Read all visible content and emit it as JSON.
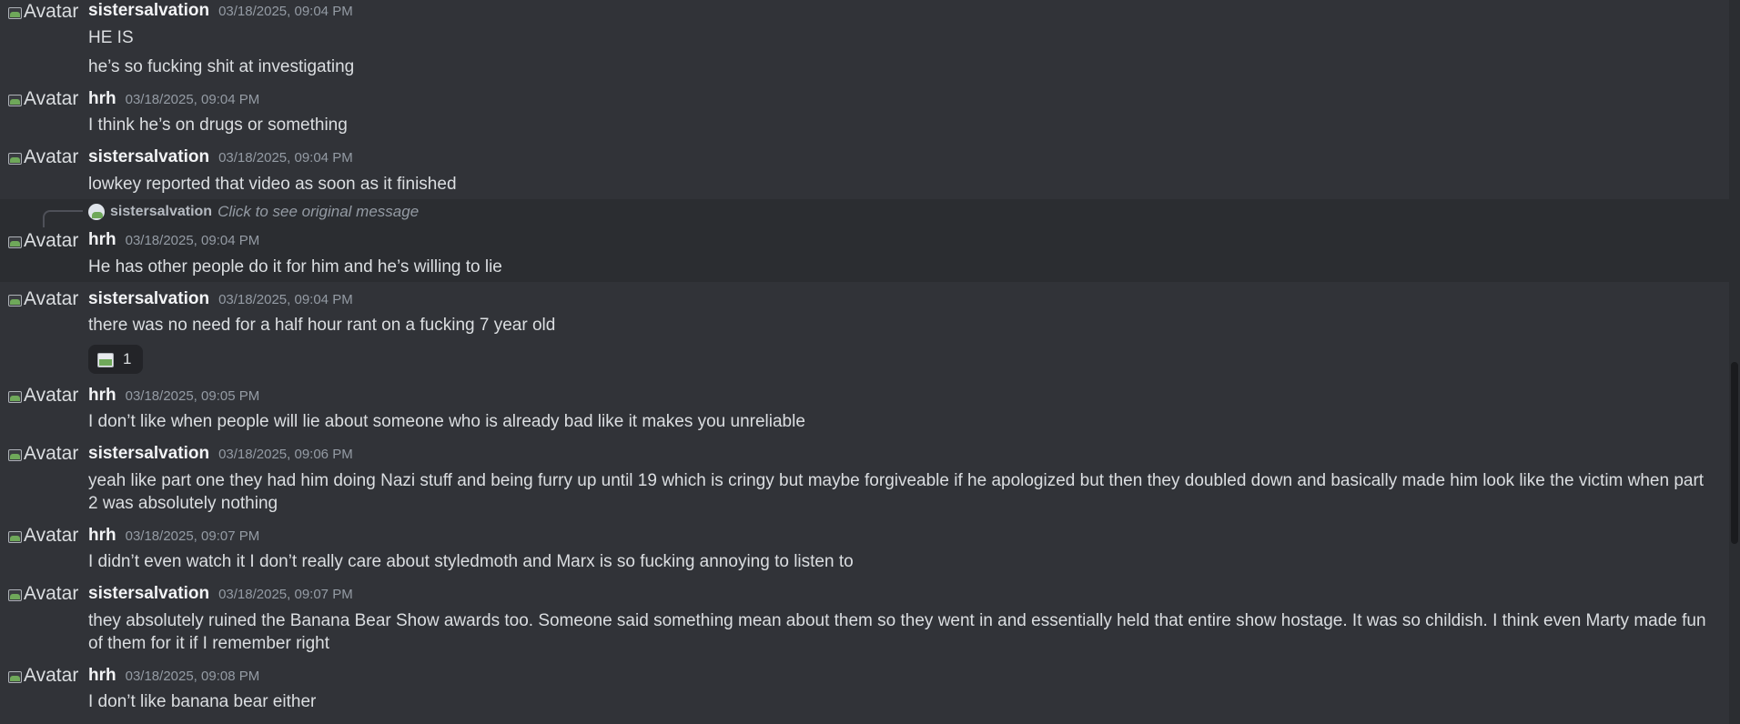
{
  "avatar_alt": "Avatar",
  "messages": [
    {
      "author": "sistersalvation",
      "time": "03/18/2025, 09:04 PM",
      "lines": [
        "HE IS",
        "he’s so fucking shit at investigating"
      ]
    },
    {
      "author": "hrh",
      "time": "03/18/2025, 09:04 PM",
      "lines": [
        "I think he’s on drugs or something"
      ]
    },
    {
      "author": "sistersalvation",
      "time": "03/18/2025, 09:04 PM",
      "lines": [
        "lowkey reported that video as soon as it finished"
      ]
    },
    {
      "author": "hrh",
      "time": "03/18/2025, 09:04 PM",
      "lines": [
        "He has other people do it for him and he’s willing to lie"
      ],
      "reply": {
        "author": "sistersalvation",
        "text": "Click to see original message"
      }
    },
    {
      "author": "sistersalvation",
      "time": "03/18/2025, 09:04 PM",
      "lines": [
        "there was no need for a half hour rant on a fucking 7 year old"
      ],
      "reaction": {
        "count": "1"
      }
    },
    {
      "author": "hrh",
      "time": "03/18/2025, 09:05 PM",
      "lines": [
        "I don’t like when people will lie about someone who is already bad like it makes you unreliable"
      ]
    },
    {
      "author": "sistersalvation",
      "time": "03/18/2025, 09:06 PM",
      "lines": [
        "yeah like part one they had him doing Nazi stuff and being furry up until 19 which is cringy but maybe forgiveable if he apologized but then they doubled down and basically made him look like the victim when part 2 was absolutely nothing"
      ]
    },
    {
      "author": "hrh",
      "time": "03/18/2025, 09:07 PM",
      "lines": [
        "I didn’t even watch it I don’t really care about styledmoth and Marx is so fucking annoying to listen to"
      ]
    },
    {
      "author": "sistersalvation",
      "time": "03/18/2025, 09:07 PM",
      "lines": [
        "they absolutely ruined the Banana Bear Show awards too. Someone said something mean about them so they went in and essentially held that entire show hostage. It was so childish. I think even Marty made fun of them for it if I remember right"
      ]
    },
    {
      "author": "hrh",
      "time": "03/18/2025, 09:08 PM",
      "lines": [
        "I don’t like banana bear either"
      ]
    }
  ]
}
